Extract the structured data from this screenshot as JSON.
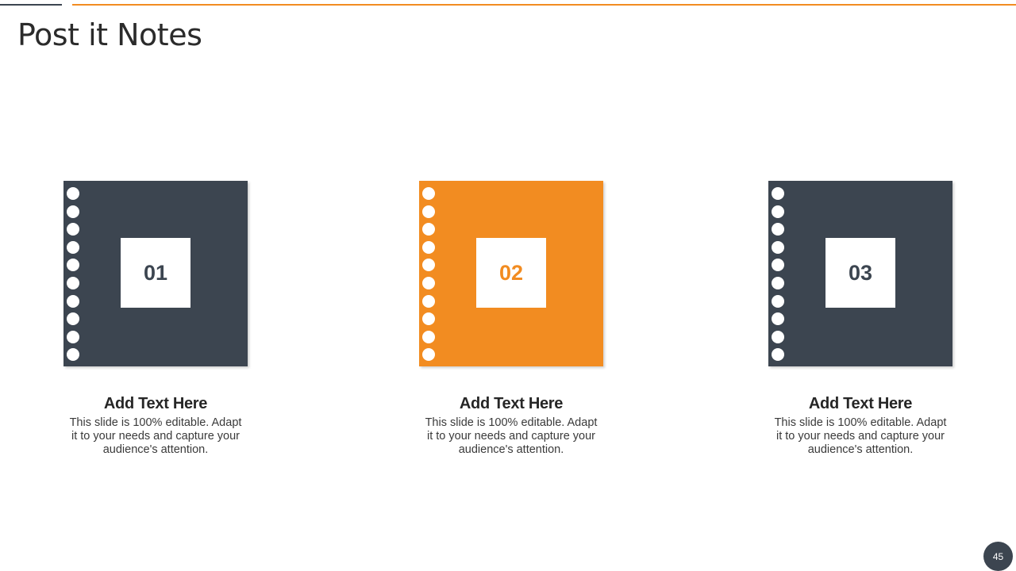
{
  "slide": {
    "title": "Post it Notes",
    "page_number": "45"
  },
  "colors": {
    "dark": "#3c4550",
    "accent": "#f28c21",
    "white": "#ffffff"
  },
  "notes": [
    {
      "number": "01",
      "heading": "Add Text Here",
      "body": "This slide is 100% editable. Adapt it to your needs and capture your audience's attention.",
      "color": "#3c4550"
    },
    {
      "number": "02",
      "heading": "Add Text Here",
      "body": "This slide is 100% editable. Adapt it to your needs and capture your audience's attention.",
      "color": "#f28c21"
    },
    {
      "number": "03",
      "heading": "Add Text Here",
      "body": "This slide is 100% editable. Adapt it to your needs and capture your audience's attention.",
      "color": "#3c4550"
    }
  ]
}
